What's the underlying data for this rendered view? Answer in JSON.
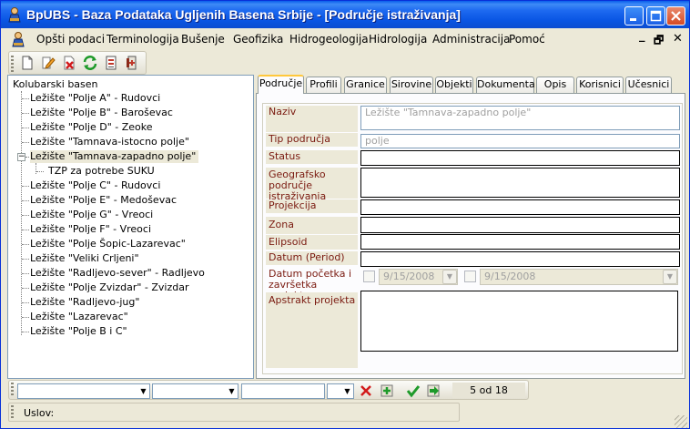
{
  "window": {
    "title": "BpUBS - Baza Podataka Ugljenih Basena Srbije - [Područje istraživanja]"
  },
  "menu": {
    "items": [
      "Opšti podaci",
      "Terminologija",
      "Bušenje",
      "Geofizika",
      "Hidrogeologija",
      "Hidrologija",
      "Administracija",
      "Pomoć"
    ],
    "mdi_minimize": "_",
    "mdi_restore": "🗗",
    "mdi_close": "✕"
  },
  "tree": {
    "root": "Kolubarski basen",
    "items": [
      "Ležište \"Polje A\" - Rudovci",
      "Ležište \"Polje B\" - Baroševac",
      "Ležište \"Polje D\" - Zeoke",
      "Ležište \"Tamnava-istocno polje\"",
      "Ležište \"Tamnava-zapadno polje\"",
      "TZP za potrebe SUKU",
      "Ležište \"Polje C\" - Rudovci",
      "Ležište \"Polje E\" - Medoševac",
      "Ležište \"Polje G\" - Vreoci",
      "Ležište \"Polje F\" - Vreoci",
      "Ležište \"Polje Šopic-Lazarevac\"",
      "Ležište \"Veliki Crljeni\"",
      "Ležište \"Radljevo-sever\" - Radljevo",
      "Ležište \"Polje Zvizdar\" - Zvizdar",
      "Ležište \"Radljevo-jug\"",
      "Ležište \"Lazarevac\"",
      "Ležište \"Polje B i C\""
    ]
  },
  "tabs": [
    "Područje",
    "Profili",
    "Granice",
    "Sirovine",
    "Objekti",
    "Dokumenta",
    "Opis",
    "Korisnici",
    "Učesnici"
  ],
  "form": {
    "naziv_label": "Naziv",
    "naziv_value": "Ležište \"Tamnava-zapadno polje\"",
    "tip_label": "Tip područja",
    "tip_value": "polje",
    "status_label": "Status",
    "status_value": "",
    "geo_label": "Geografsko područje istraživanja",
    "geo_value": "",
    "projekcija_label": "Projekcija",
    "projekcija_value": "",
    "zona_label": "Zona",
    "zona_value": "",
    "elipsoid_label": "Elipsoid",
    "elipsoid_value": "",
    "datum_label": "Datum (Period)",
    "datum_value": "",
    "pocetak_label": "Datum početka i završetka projekta",
    "date_start": "9/15/2008",
    "date_end": "9/15/2008",
    "apstrakt_label": "Apstrakt projekta",
    "apstrakt_value": ""
  },
  "bottombar": {
    "record_count": "5 od  18"
  },
  "status": {
    "label": "Uslov:"
  }
}
